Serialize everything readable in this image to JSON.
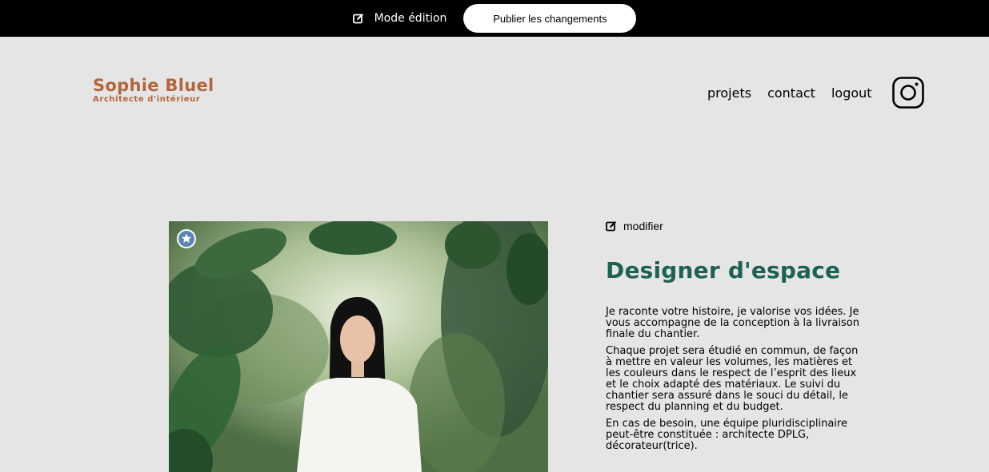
{
  "editbar": {
    "mode_label": "Mode édition",
    "publish_label": "Publier les changements"
  },
  "header": {
    "logo_name": "Sophie Bluel",
    "logo_subtitle": "Architecte d'intérieur",
    "nav": [
      "projets",
      "contact",
      "logout"
    ]
  },
  "intro": {
    "modify_label": "modifier",
    "title": "Designer d'espace",
    "paragraphs": [
      "Je raconte votre histoire, je valorise vos idées. Je vous accompagne de la conception à la livraison finale du chantier.",
      "Chaque projet sera étudié en commun, de façon à mettre en valeur les volumes, les matières et les couleurs dans le respect de l’esprit des lieux et le choix adapté des matériaux. Le suivi du chantier sera assuré dans le souci du détail, le respect du planning et du budget.",
      "En cas de besoin, une équipe pluridisciplinaire peut-être constituée : architecte DPLG, décorateur(trice)."
    ]
  },
  "colors": {
    "editbar_bg": "#000000",
    "page_bg": "#e5e5e5",
    "brand": "#b1663c",
    "title": "#1d6154"
  },
  "icons": [
    "edit-icon",
    "instagram-icon",
    "star-icon"
  ]
}
